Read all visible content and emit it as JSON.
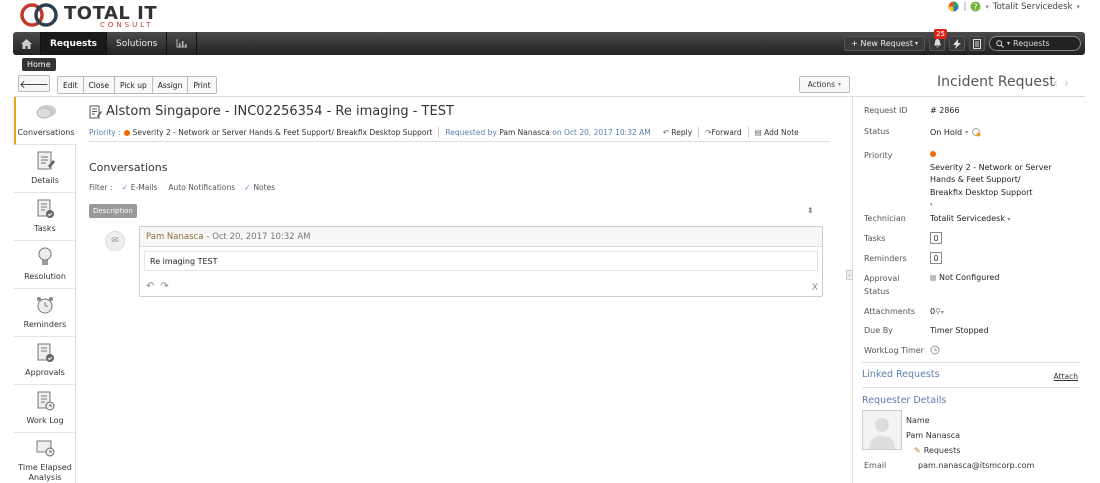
{
  "header": {
    "logo_total": "TOTAL IT",
    "logo_consult": "CONSULT",
    "user_name": "Totalit Servicedesk"
  },
  "nav": {
    "tabs": [
      {
        "label": "Requests"
      },
      {
        "label": "Solutions"
      }
    ],
    "new_request": "+ New Request",
    "notification_count": "25",
    "search_placeholder": "Requests",
    "home_tooltip": "Home"
  },
  "toolbar": {
    "buttons": [
      "Edit",
      "Close",
      "Pick up",
      "Assign",
      "Print"
    ],
    "actions_label": "Actions"
  },
  "page_title": "Incident Request",
  "sidebar": {
    "items": [
      {
        "label": "Conversations"
      },
      {
        "label": "Details"
      },
      {
        "label": "Tasks"
      },
      {
        "label": "Resolution"
      },
      {
        "label": "Reminders"
      },
      {
        "label": "Approvals"
      },
      {
        "label": "Work Log"
      },
      {
        "label": "Time Elapsed Analysis"
      }
    ]
  },
  "request": {
    "title": "Alstom Singapore - INC02256354 - Re imaging - TEST",
    "priority_label": "Priority :",
    "priority_value": "Severity 2 - Network or Server Hands & Feet Support/ Breakfix Desktop Support",
    "requested_by_label": "Requested by",
    "requester": "Pam Nanasca",
    "on_label": "on",
    "date": "Oct 20, 2017 10:32 AM",
    "reply": "Reply",
    "forward": "Forward",
    "add_note": "Add Note"
  },
  "conversations": {
    "heading": "Conversations",
    "filter_label": "Filter :",
    "filters": [
      "E-Mails",
      "Auto Notifications",
      "Notes"
    ],
    "description_tag": "Description",
    "author": "Pam Nanasca",
    "author_date": "- Oct 20, 2017 10:32 AM",
    "body": "Re imaging TEST",
    "close_x": "X"
  },
  "properties": {
    "request_id_label": "Request ID",
    "request_id": "# 2866",
    "status_label": "Status",
    "status": "On Hold",
    "priority_label": "Priority",
    "priority": "Severity 2 - Network or Server Hands & Feet Support/ Breakfix Desktop Support",
    "technician_label": "Technician",
    "technician": "Totalit Servicedesk",
    "tasks_label": "Tasks",
    "tasks": "0",
    "reminders_label": "Reminders",
    "reminders": "0",
    "approval_label": "Approval Status",
    "approval": "Not Configured",
    "attachments_label": "Attachments",
    "attachments": "0",
    "due_by_label": "Due By",
    "due_by": "Timer Stopped",
    "worklog_label": "WorkLog Timer",
    "linked_requests": "Linked Requests",
    "attach": "Attach",
    "requester_details": "Requester Details",
    "name_label": "Name",
    "name": "Pam Nanasca",
    "requests_link": "Requests",
    "email_label": "Email",
    "email": "pam.nanasca@itsmcorp.com"
  }
}
